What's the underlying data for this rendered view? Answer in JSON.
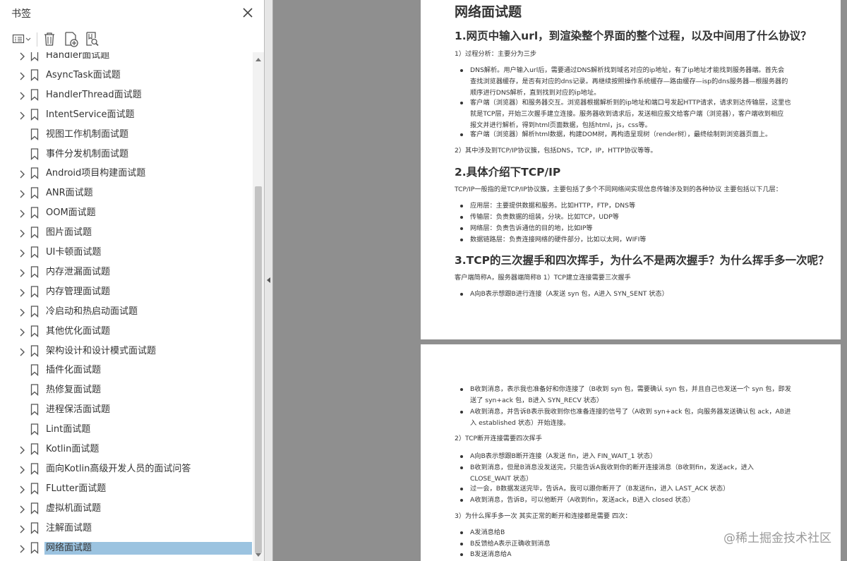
{
  "panel": {
    "title": "书签",
    "items": [
      {
        "label": "Handler面试题",
        "expandable": true
      },
      {
        "label": "AsyncTask面试题",
        "expandable": true
      },
      {
        "label": "HandlerThread面试题",
        "expandable": true
      },
      {
        "label": "IntentService面试题",
        "expandable": true
      },
      {
        "label": "视图工作机制面试题",
        "expandable": false
      },
      {
        "label": "事件分发机制面试题",
        "expandable": false
      },
      {
        "label": "Android项目构建面试题",
        "expandable": true
      },
      {
        "label": "ANR面试题",
        "expandable": true
      },
      {
        "label": "OOM面试题",
        "expandable": true
      },
      {
        "label": "图片面试题",
        "expandable": true
      },
      {
        "label": "UI卡顿面试题",
        "expandable": true
      },
      {
        "label": "内存泄漏面试题",
        "expandable": true
      },
      {
        "label": "内存管理面试题",
        "expandable": true
      },
      {
        "label": "冷启动和热启动面试题",
        "expandable": true
      },
      {
        "label": "其他优化面试题",
        "expandable": true
      },
      {
        "label": "架构设计和设计模式面试题",
        "expandable": true
      },
      {
        "label": "插件化面试题",
        "expandable": false
      },
      {
        "label": "热修复面试题",
        "expandable": false
      },
      {
        "label": "进程保活面试题",
        "expandable": false
      },
      {
        "label": "Lint面试题",
        "expandable": false
      },
      {
        "label": "Kotlin面试题",
        "expandable": true
      },
      {
        "label": "面向Kotlin高级开发人员的面试问答",
        "expandable": true
      },
      {
        "label": "FLutter面试题",
        "expandable": true
      },
      {
        "label": "虚拟机面试题",
        "expandable": true
      },
      {
        "label": "注解面试题",
        "expandable": true
      },
      {
        "label": "网络面试题",
        "expandable": true,
        "selected": true
      }
    ]
  },
  "page1": {
    "title": "网络面试题",
    "q1": "1.网页中输入url，到渲染整个界面的整个过程，以及中间用了什么协议？",
    "q1_p1": "1）过程分析：主要分为三步",
    "q1_bullets": [
      [
        "DNS解析。用户输入url后，需要通过DNS解析找到域名对应的ip地址，有了ip地址才能找到服务器端。首先会",
        "查找浏览器缓存，是否有对应的dns记录。再继续按照操作系统缓存—路由缓存—isp的dns服务器—根服务器的",
        "顺序进行DNS解析，直到找到对应的ip地址。"
      ],
      [
        "客户端（浏览器）和服务器交互。浏览器根据解析到的ip地址和端口号发起HTTP请求，请求到达传输层，这里也",
        "就是TCP层，开始三次握手建立连接。服务器收到请求后，发送相应报文给客户端（浏览器），客户端收到相应",
        "报文并进行解析，得到html页面数据，包括html，js，css等。"
      ],
      [
        "客户端（浏览器）解析html数据，构建DOM树，再构造呈现树（render树），最终绘制到浏览器页面上。"
      ]
    ],
    "q1_p2": "2）其中涉及到TCP/IP协议簇，包括DNS，TCP，IP，HTTP协议等等。",
    "q2": "2.具体介绍下TCP/IP",
    "q2_p1": "TCP/IP一般指的是TCP/IP协议簇，主要包括了多个不同网络间实现信息传输涉及到的各种协议 主要包括以下几层：",
    "q2_bullets": [
      [
        "应用层：主要提供数据和服务。比如HTTP，FTP，DNS等"
      ],
      [
        "传输层：负责数据的组装，分块。比如TCP，UDP等"
      ],
      [
        "网络层：负责告诉通信的目的地，比如IP等"
      ],
      [
        "数据链路层：负责连接网络的硬件部分，比如以太网，WIFI等"
      ]
    ],
    "q3": "3.TCP的三次握手和四次挥手，为什么不是两次握手？为什么挥手多一次呢？",
    "q3_p1": "客户端简称A，服务器端简称B 1）TCP建立连接需要三次握手",
    "q3_bullets": [
      [
        "A向B表示想跟B进行连接（A发送 syn 包，A进入 SYN_SENT 状态）"
      ]
    ]
  },
  "page2": {
    "bullets_a": [
      [
        "B收到消息，表示我也准备好和你连接了（B收到 syn 包，需要确认 syn 包，并且自己也发送一个 syn 包，即发",
        "送了 syn+ack 包，B进入 SYN_RECV 状态）"
      ],
      [
        "A收到消息，并告诉B表示我收到你也准备连接的信号了（A收到 syn+ack 包，向服务器发送确认包 ack，AB进",
        "入 established 状态）开始连接。"
      ]
    ],
    "p2": "2）TCP断开连接需要四次挥手",
    "bullets_b": [
      [
        "A向B表示想跟B断开连接（A发送 fin，进入 FIN_WAIT_1 状态）"
      ],
      [
        "B收到消息，但是B消息没发送完，只能告诉A我收到你的断开连接消息（B收到fin，发送ack，进入",
        "CLOSE_WAIT 状态）"
      ],
      [
        "过一会，B数据发送完毕，告诉A，我可以跟你断开了（B发送fin，进入 LAST_ACK 状态）"
      ],
      [
        "A收到消息，告诉B，可以他断开（A收到fin，发送ack，B进入 closed 状态）"
      ]
    ],
    "p3": "3）为什么挥手多一次 其实正常的断开和连接都是需要 四次：",
    "bullets_c": [
      [
        "A发消息给B"
      ],
      [
        "B反馈给A表示正确收到消息"
      ],
      [
        "B发送消息给A"
      ]
    ]
  },
  "watermark": "@稀土掘金技术社区"
}
